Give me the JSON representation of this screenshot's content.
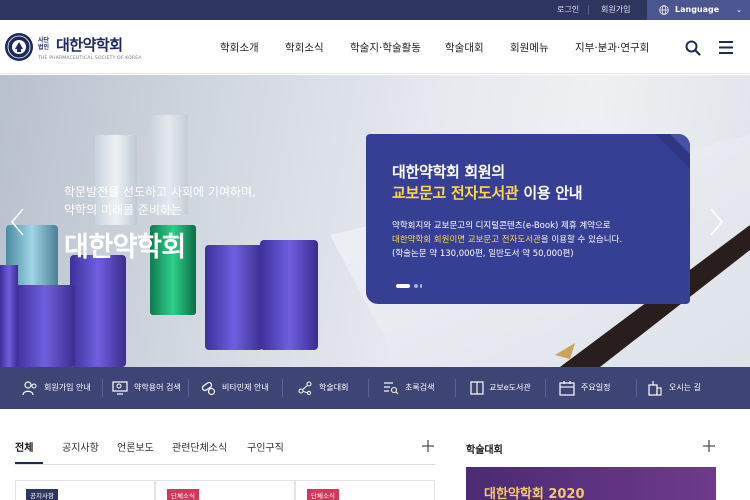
{
  "topbar": {
    "login": "로그인",
    "join": "회원가입",
    "language": "Language"
  },
  "header": {
    "logo_small": "사단법인",
    "logo_name": "대한약학회",
    "logo_sub": "THE PHARMACEUTICAL SOCIETY OF KOREA",
    "nav": [
      "학회소개",
      "학회소식",
      "학술지·학술활동",
      "학술대회",
      "회원메뉴",
      "지부·분과·연구회"
    ]
  },
  "hero": {
    "line1": "학문발전을 선도하고 사회에 기여하며,",
    "line2": "약학의 미래를 준비하는",
    "title": "대한약학회"
  },
  "card": {
    "title1": "대한약학회 회원의",
    "title2_highlight": "교보문고 전자도서관",
    "title2_rest": " 이용 안내",
    "desc1": "약학회지와 교보문고의 디지털콘텐츠(e-Book) 제휴 계약으로",
    "desc2_highlight": "대한약학회 회원이면 교보문고 전자도서관",
    "desc2_rest": "을 이용할 수 있습니다.",
    "desc3": "(학술논문 약 130,000편, 일반도서 약 50,000편)"
  },
  "quick_menu": [
    {
      "label": "회원가입 안내",
      "icon": "users-icon"
    },
    {
      "label": "약학용어 검색",
      "icon": "monitor-search-icon"
    },
    {
      "label": "비타민제 안내",
      "icon": "pills-icon"
    },
    {
      "label": "학술대회",
      "icon": "network-icon"
    },
    {
      "label": "초록검색",
      "icon": "list-search-icon"
    },
    {
      "label": "교보e도서관",
      "icon": "book-icon"
    },
    {
      "label": "주요일정",
      "icon": "calendar-icon"
    },
    {
      "label": "오시는 길",
      "icon": "building-icon"
    }
  ],
  "news": {
    "tabs": [
      "전체",
      "공지사항",
      "언론보도",
      "관련단체소식",
      "구인구직"
    ],
    "badges": [
      "공지사항",
      "단체소식",
      "단체소식"
    ]
  },
  "conference": {
    "title": "학술대회",
    "banner": "대한약학회 2020"
  },
  "colors": {
    "topbar": "#2e3660",
    "brand": "#1f2a5c",
    "card": "#353f93",
    "highlight": "#ffd84a",
    "quickbar": "#3d4575"
  }
}
